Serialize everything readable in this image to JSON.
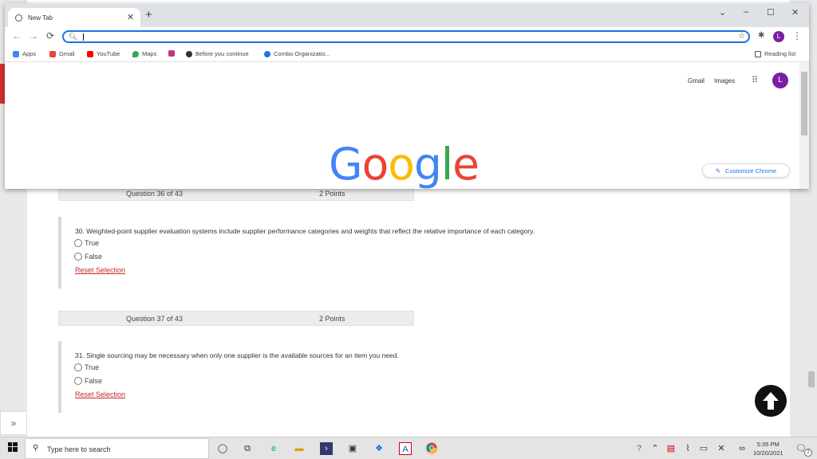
{
  "browser": {
    "tab_title": "New Tab",
    "address_value": "",
    "avatar_letter": "L",
    "reading_list": "Reading list",
    "bookmarks": [
      {
        "label": "Apps",
        "icon": "apps-grid-icon",
        "color": "#4285f4"
      },
      {
        "label": "Gmail",
        "icon": "gmail-icon",
        "color": "#ea4335"
      },
      {
        "label": "YouTube",
        "icon": "youtube-icon",
        "color": "#ff0000"
      },
      {
        "label": "Maps",
        "icon": "maps-icon",
        "color": "#34a853"
      },
      {
        "label": "",
        "icon": "instagram-icon",
        "color": "#c13584"
      },
      {
        "label": "Before you continue",
        "icon": "shield-icon",
        "color": "#333333"
      },
      {
        "label": "Combo Organizatio...",
        "icon": "search-q-icon",
        "color": "#1a73e8"
      }
    ]
  },
  "newtab": {
    "gmail": "Gmail",
    "images": "Images",
    "avatar_letter": "L",
    "logo_letters": [
      {
        "ch": "G",
        "color": "#4285f4"
      },
      {
        "ch": "o",
        "color": "#ea4335"
      },
      {
        "ch": "o",
        "color": "#fbbc05"
      },
      {
        "ch": "g",
        "color": "#4285f4"
      },
      {
        "ch": "l",
        "color": "#34a853"
      },
      {
        "ch": "e",
        "color": "#ea4335"
      }
    ],
    "customize": "Customize Chrome"
  },
  "quiz": {
    "q36_header": {
      "number": "Question 36 of 43",
      "points": "2 Points"
    },
    "q30": {
      "text": "30. Weighted-point supplier evaluation systems include supplier performance categories and weights that reflect the relative importance of each category.",
      "options": [
        "True",
        "False"
      ],
      "reset": "Reset Selection"
    },
    "q37_header": {
      "number": "Question 37 of 43",
      "points": "2 Points"
    },
    "q31": {
      "text": "31. Single sourcing may be necessary when only one supplier is the available sources for an item you need.",
      "options": [
        "True",
        "False"
      ],
      "reset": "Reset Selection"
    }
  },
  "taskbar": {
    "search_placeholder": "Type here to search",
    "time": "5:35 PM",
    "date": "10/20/2021",
    "notification_count": "2"
  }
}
